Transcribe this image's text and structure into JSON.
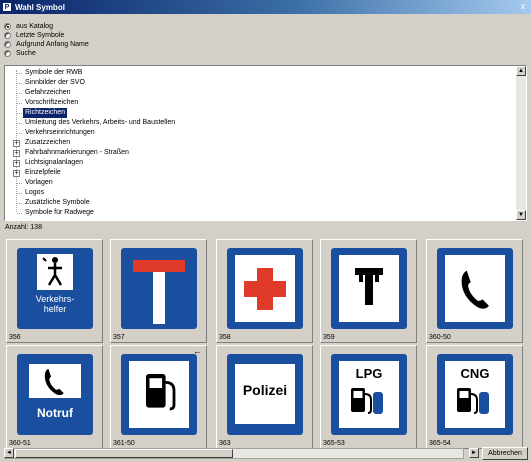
{
  "window": {
    "title": "Wahl Symbol",
    "icon_letter": "P",
    "close_glyph": "x"
  },
  "options": [
    {
      "label": "aus Katalog",
      "checked": true
    },
    {
      "label": "Letzte Symbole",
      "checked": false
    },
    {
      "label": "Aufgrund Anfang Name",
      "checked": false
    },
    {
      "label": "Suche",
      "checked": false
    }
  ],
  "tree": {
    "items": [
      {
        "label": "Symbole der RWB",
        "expander": ""
      },
      {
        "label": "Sinnbilder der SVO",
        "expander": ""
      },
      {
        "label": "Gefahrzeichen",
        "expander": ""
      },
      {
        "label": "Vorschriftzeichen",
        "expander": ""
      },
      {
        "label": "Richtzeichen",
        "expander": "",
        "selected": true
      },
      {
        "label": "Umleitung des Verkehrs, Arbeits- und Baustellen",
        "expander": ""
      },
      {
        "label": "Verkehrseinrichtungen",
        "expander": ""
      },
      {
        "label": "Zusatzzeichen",
        "expander": "+"
      },
      {
        "label": "Fahrbahnmarkierungen - Straßen",
        "expander": "+"
      },
      {
        "label": "Lichtsignalanlagen",
        "expander": "+"
      },
      {
        "label": "Einzelpfeile",
        "expander": "+"
      },
      {
        "label": "Vorlagen",
        "expander": ""
      },
      {
        "label": "Logos",
        "expander": ""
      },
      {
        "label": "Zusätzliche Symbole",
        "expander": ""
      },
      {
        "label": "Symbole für Radwege",
        "expander": ""
      }
    ]
  },
  "count_label": "Anzahl: 138",
  "symbols": [
    {
      "code": "356",
      "kind": "helper",
      "text": "Verkehrs-\nhelfer"
    },
    {
      "code": "357",
      "kind": "deadend"
    },
    {
      "code": "358",
      "kind": "firstaid"
    },
    {
      "code": "359",
      "kind": "wrench"
    },
    {
      "code": "360-50",
      "kind": "phone"
    },
    {
      "code": "360-51",
      "kind": "notruf",
      "text": "Notruf"
    },
    {
      "code": "361-50",
      "kind": "fuel",
      "arrow": true
    },
    {
      "code": "363",
      "kind": "polizei",
      "text": "Polizei"
    },
    {
      "code": "365-53",
      "kind": "lpg",
      "text": "LPG"
    },
    {
      "code": "365-54",
      "kind": "cng",
      "text": "CNG"
    }
  ],
  "grid_arrow": "←",
  "corner_arrow": "←",
  "scroll": {
    "left": "◄",
    "right": "►",
    "up": "▲",
    "down": "▼"
  },
  "cancel_label": "Abbrechen",
  "colors": {
    "sign_blue": "#1a4fa0",
    "sign_red": "#e03a2a",
    "selection": "#0a246a"
  }
}
